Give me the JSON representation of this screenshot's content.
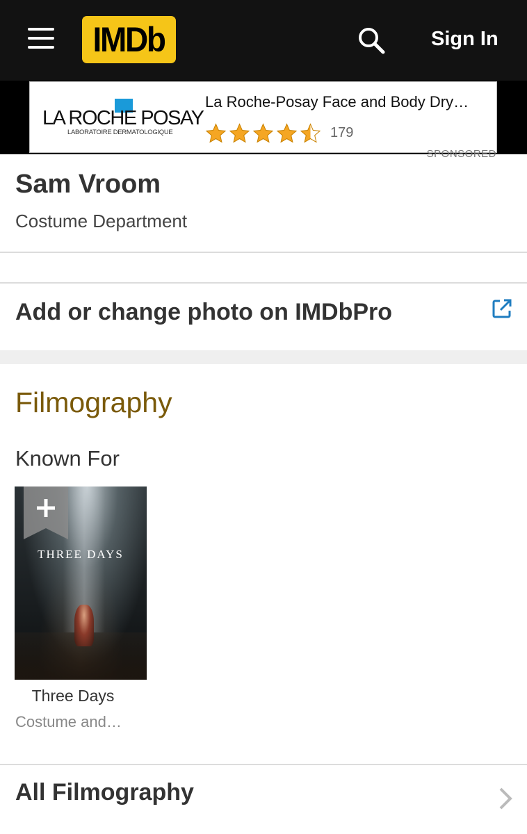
{
  "header": {
    "logo_text": "IMDb",
    "sign_in_label": "Sign In",
    "logo_color": "#f5c518",
    "bar_color": "#121212"
  },
  "ad": {
    "brand_name": "LA ROCHE POSAY",
    "brand_subtitle": "LABORATOIRE DERMATOLOGIQUE",
    "title": "La Roche-Posay Face and Body Dry…",
    "rating_stars": 4.5,
    "rating_count": "179",
    "sponsored_label": "SPONSORED",
    "star_color": "#f5a623"
  },
  "person": {
    "name": "Sam Vroom",
    "department": "Costume Department"
  },
  "imdbpro": {
    "label": "Add or change photo on IMDbPro",
    "icon": "external-link-icon",
    "icon_color": "#1f7dc0"
  },
  "filmography": {
    "heading": "Filmography",
    "heading_color": "#7a5a0a",
    "known_for_label": "Known For",
    "known_for": [
      {
        "poster_text": "THREE DAYS",
        "title": "Three Days",
        "role": "Costume and…"
      }
    ],
    "all_label": "All Filmography"
  }
}
